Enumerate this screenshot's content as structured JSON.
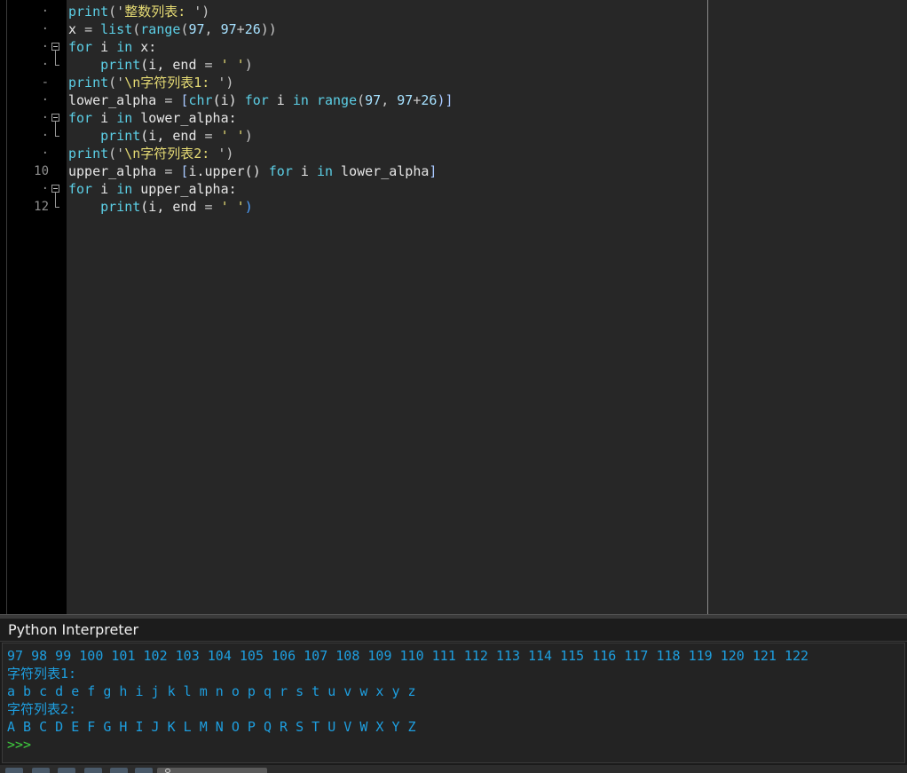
{
  "editor": {
    "gutter": {
      "line_markers": [
        "·",
        "·",
        "·",
        "·",
        "-",
        "·",
        "·",
        "·",
        "·",
        "10",
        "·",
        "12"
      ]
    },
    "lines": [
      [
        {
          "t": "print",
          "c": "kw"
        },
        {
          "t": "('",
          "c": "op"
        },
        {
          "t": "整数列表: ",
          "c": "str"
        },
        {
          "t": "')",
          "c": "op"
        }
      ],
      [
        {
          "t": "x ",
          "c": ""
        },
        {
          "t": "= ",
          "c": "op"
        },
        {
          "t": "list",
          "c": "kw"
        },
        {
          "t": "(",
          "c": "op"
        },
        {
          "t": "range",
          "c": "kw"
        },
        {
          "t": "(",
          "c": "op"
        },
        {
          "t": "97",
          "c": "num"
        },
        {
          "t": ", ",
          "c": "op"
        },
        {
          "t": "97",
          "c": "num"
        },
        {
          "t": "+",
          "c": "op"
        },
        {
          "t": "26",
          "c": "num"
        },
        {
          "t": "))",
          "c": "op"
        }
      ],
      [
        {
          "t": "for",
          "c": "kw"
        },
        {
          "t": " i ",
          "c": ""
        },
        {
          "t": "in",
          "c": "kw"
        },
        {
          "t": " x:",
          "c": ""
        }
      ],
      [
        {
          "t": "    ",
          "c": ""
        },
        {
          "t": "print",
          "c": "kw"
        },
        {
          "t": "(i, ",
          "c": ""
        },
        {
          "t": "end",
          "c": ""
        },
        {
          "t": " = ",
          "c": "op"
        },
        {
          "t": "' '",
          "c": "str"
        },
        {
          "t": ")",
          "c": "op"
        }
      ],
      [
        {
          "t": "print",
          "c": "kw"
        },
        {
          "t": "('",
          "c": "op"
        },
        {
          "t": "\\n字符列表1: ",
          "c": "str"
        },
        {
          "t": "')",
          "c": "op"
        }
      ],
      [
        {
          "t": "lower_alpha ",
          "c": ""
        },
        {
          "t": "= ",
          "c": "op"
        },
        {
          "t": "[",
          "c": "brk"
        },
        {
          "t": "chr",
          "c": "kw"
        },
        {
          "t": "(i) ",
          "c": ""
        },
        {
          "t": "for",
          "c": "kw"
        },
        {
          "t": " i ",
          "c": ""
        },
        {
          "t": "in",
          "c": "kw"
        },
        {
          "t": " ",
          "c": ""
        },
        {
          "t": "range",
          "c": "kw"
        },
        {
          "t": "(",
          "c": "op"
        },
        {
          "t": "97",
          "c": "num"
        },
        {
          "t": ", ",
          "c": "op"
        },
        {
          "t": "97",
          "c": "num"
        },
        {
          "t": "+",
          "c": "op"
        },
        {
          "t": "26",
          "c": "num"
        },
        {
          "t": ")]",
          "c": "brk"
        }
      ],
      [
        {
          "t": "for",
          "c": "kw"
        },
        {
          "t": " i ",
          "c": ""
        },
        {
          "t": "in",
          "c": "kw"
        },
        {
          "t": " lower_alpha:",
          "c": ""
        }
      ],
      [
        {
          "t": "    ",
          "c": ""
        },
        {
          "t": "print",
          "c": "kw"
        },
        {
          "t": "(i, ",
          "c": ""
        },
        {
          "t": "end",
          "c": ""
        },
        {
          "t": " = ",
          "c": "op"
        },
        {
          "t": "' '",
          "c": "str"
        },
        {
          "t": ")",
          "c": "op"
        }
      ],
      [
        {
          "t": "print",
          "c": "kw"
        },
        {
          "t": "('",
          "c": "op"
        },
        {
          "t": "\\n字符列表2: ",
          "c": "str"
        },
        {
          "t": "')",
          "c": "op"
        }
      ],
      [
        {
          "t": "upper_alpha ",
          "c": ""
        },
        {
          "t": "= ",
          "c": "op"
        },
        {
          "t": "[",
          "c": "brk"
        },
        {
          "t": "i.upper() ",
          "c": ""
        },
        {
          "t": "for",
          "c": "kw"
        },
        {
          "t": " i ",
          "c": ""
        },
        {
          "t": "in",
          "c": "kw"
        },
        {
          "t": " lower_alpha",
          "c": ""
        },
        {
          "t": "]",
          "c": "brk"
        }
      ],
      [
        {
          "t": "for",
          "c": "kw"
        },
        {
          "t": " i ",
          "c": ""
        },
        {
          "t": "in",
          "c": "kw"
        },
        {
          "t": " upper_alpha:",
          "c": ""
        }
      ],
      [
        {
          "t": "    ",
          "c": ""
        },
        {
          "t": "print",
          "c": "kw"
        },
        {
          "t": "(i, ",
          "c": ""
        },
        {
          "t": "end",
          "c": ""
        },
        {
          "t": " = ",
          "c": "op"
        },
        {
          "t": "' '",
          "c": "str"
        },
        {
          "t": ")",
          "c": "hl"
        }
      ]
    ]
  },
  "interpreter": {
    "title": "Python Interpreter",
    "output": [
      "97 98 99 100 101 102 103 104 105 106 107 108 109 110 111 112 113 114 115 116 117 118 119 120 121 122",
      "字符列表1:",
      "a b c d e f g h i j k l m n o p q r s t u v w x y z",
      "字符列表2:",
      "A B C D E F G H I J K L M N O P Q R S T U V W X Y Z"
    ],
    "prompt": ">>>"
  },
  "icons": {
    "fold": "fold-collapse-icon",
    "search": "search-icon"
  },
  "colors": {
    "editor_bg": "#272727",
    "gutter_bg": "#000000",
    "keyword": "#5ccfe6",
    "string": "#e6db74",
    "output": "#1e9fe0",
    "prompt": "#3fd03f"
  }
}
